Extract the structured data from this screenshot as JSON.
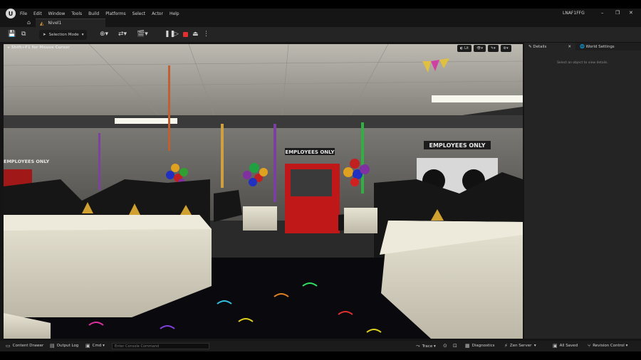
{
  "menu": {
    "items": [
      "File",
      "Edit",
      "Window",
      "Tools",
      "Build",
      "Platforms",
      "Select",
      "Actor",
      "Help"
    ],
    "window_title": "LNAF1FFG"
  },
  "tab": {
    "label": "Nivel1"
  },
  "toolbar": {
    "selection_mode": "Selection Mode"
  },
  "viewport": {
    "hint": "Shift+F1 for Mouse Cursor",
    "lit_label": "Lit",
    "sign_left": "EMPLOYEES ONLY",
    "sign_center": "EMPLOYEES ONLY",
    "sign_right": "EMPLOYEES ONLY"
  },
  "details": {
    "tab_details": "Details",
    "tab_world": "World Settings",
    "empty_message": "Select an object to view details."
  },
  "status": {
    "content_drawer": "Content Drawer",
    "output_log": "Output Log",
    "cmd": "Cmd",
    "console_placeholder": "Enter Console Command",
    "trace": "Trace",
    "diagnostics": "Diagnostics",
    "zen_server": "Zen Server",
    "all_saved": "All Saved",
    "revision_control": "Revision Control"
  },
  "colors": {
    "accent_tab_icon": "#e0a030",
    "stop": "#e03030",
    "door": "#c01818"
  }
}
